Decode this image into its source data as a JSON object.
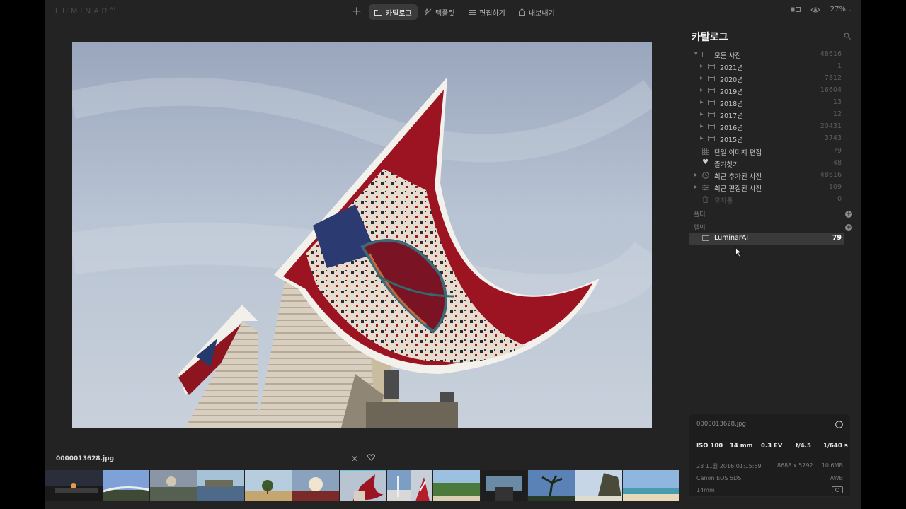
{
  "app": {
    "logo": "LUMINAR",
    "logo_sup": "AI"
  },
  "toolbar": {
    "tabs": [
      {
        "label": "카탈로그",
        "icon": "folder-icon",
        "active": true
      },
      {
        "label": "템플릿",
        "icon": "templates-icon",
        "active": false
      },
      {
        "label": "편집하기",
        "icon": "edit-sliders-icon",
        "active": false
      },
      {
        "label": "내보내기",
        "icon": "export-icon",
        "active": false
      }
    ],
    "zoom": "27%"
  },
  "panel": {
    "title": "카탈로그",
    "all_photos": {
      "label": "모든 사진",
      "count": "48616"
    },
    "years": [
      {
        "label": "2021년",
        "count": "1"
      },
      {
        "label": "2020년",
        "count": "7812"
      },
      {
        "label": "2019년",
        "count": "16604"
      },
      {
        "label": "2018년",
        "count": "13"
      },
      {
        "label": "2017년",
        "count": "12"
      },
      {
        "label": "2016년",
        "count": "20431"
      },
      {
        "label": "2015년",
        "count": "3743"
      }
    ],
    "single_edits": {
      "label": "단일 이미지 편집",
      "count": "79"
    },
    "favorites": {
      "label": "즐겨찾기",
      "count": "48"
    },
    "recent_added": {
      "label": "최근 추가된 사진",
      "count": "48616"
    },
    "recent_edited": {
      "label": "최근 편집된 사진",
      "count": "109"
    },
    "trash": {
      "label": "휴지통",
      "count": "0"
    },
    "folders_label": "폴더",
    "albums_label": "앨범",
    "album": {
      "label": "LuminarAI",
      "count": "79"
    }
  },
  "info": {
    "filename": "0000013628.jpg",
    "iso": "ISO 100",
    "focal": "14 mm",
    "ev": "0.3 EV",
    "aperture": "f/4.5",
    "shutter": "1/640 s",
    "date": "23 11월 2016 01:15:59",
    "dimensions": "8688 x 5792",
    "size": "10.6MB",
    "camera": "Canon EOS 5DS",
    "wb": "AWB",
    "lens": "14mm"
  },
  "filmstrip": {
    "filename": "0000013628.jpg"
  },
  "colors": {
    "accent_selected": "#6ec2e6",
    "background": "#232323"
  }
}
